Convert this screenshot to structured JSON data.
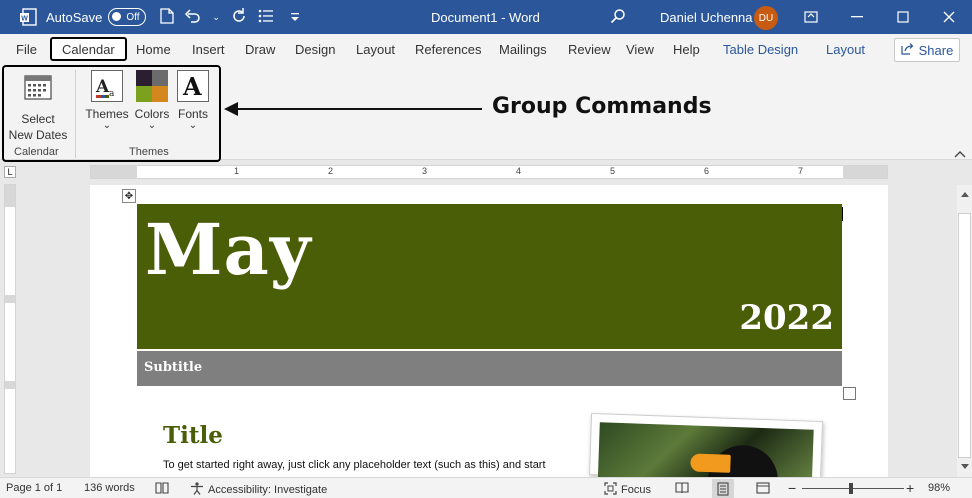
{
  "titlebar": {
    "autosave_label": "AutoSave",
    "autosave_state": "Off",
    "doc_title": "Document1  -  Word",
    "user_name": "Daniel Uchenna",
    "user_initials": "DU"
  },
  "tabs": [
    "File",
    "Calendar",
    "Home",
    "Insert",
    "Draw",
    "Design",
    "Layout",
    "References",
    "Mailings",
    "Review",
    "View",
    "Help",
    "Table Design",
    "Layout"
  ],
  "share_label": "Share",
  "ribbon": {
    "select_dates_line1": "Select",
    "select_dates_line2": "New Dates",
    "themes_label": "Themes",
    "colors_label": "Colors",
    "fonts_label": "Fonts",
    "group_calendar": "Calendar",
    "group_themes": "Themes",
    "themes_caret": "⌄",
    "colors_caret": "⌄",
    "fonts_caret": "⌄"
  },
  "annotation": "Group Commands",
  "ruler": {
    "numbers": [
      "1",
      "2",
      "3",
      "4",
      "5",
      "6",
      "7"
    ],
    "corner": "L"
  },
  "document": {
    "month": "May",
    "year": "2022",
    "subtitle": "Subtitle",
    "title": "Title",
    "body": "To get started right away, just click any placeholder text (such as this) and start"
  },
  "status": {
    "page": "Page 1 of 1",
    "words": "136 words",
    "accessibility": "Accessibility: Investigate",
    "focus": "Focus",
    "zoom_minus": "−",
    "zoom_plus": "+",
    "zoom": "98%"
  },
  "colors": {
    "titlebar": "#2b579a",
    "month_band": "#4a5d07",
    "subtitle_band": "#7f7f7f",
    "avatar": "#c75b12"
  }
}
